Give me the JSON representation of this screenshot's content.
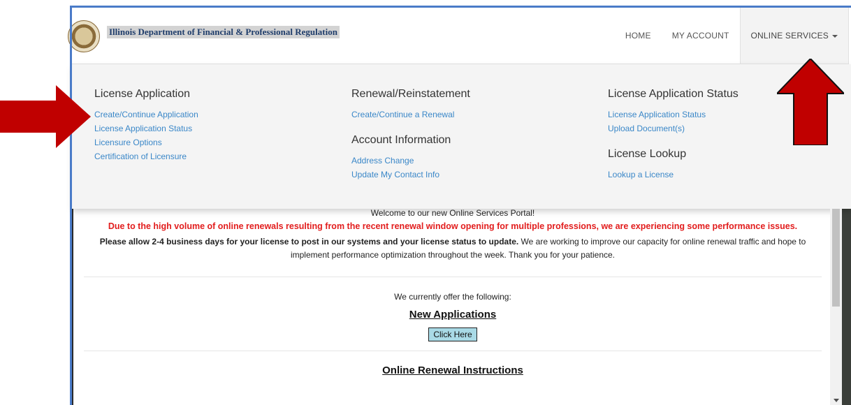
{
  "header": {
    "brand_name": "Illinois Department of Financial & Professional Regulation",
    "nav": {
      "home": "HOME",
      "my_account": "MY ACCOUNT",
      "online_services": "ONLINE SERVICES"
    }
  },
  "menu": {
    "license_application": {
      "title": "License Application",
      "links": [
        "Create/Continue Application",
        "License Application Status",
        "Licensure Options",
        "Certification of Licensure"
      ]
    },
    "renewal": {
      "title": "Renewal/Reinstatement",
      "links": [
        "Create/Continue a Renewal"
      ]
    },
    "account_information": {
      "title": "Account Information",
      "links": [
        "Address Change",
        "Update My Contact Info"
      ]
    },
    "application_status": {
      "title": "License Application Status",
      "links": [
        "License Application Status",
        "Upload Document(s)"
      ]
    },
    "license_lookup": {
      "title": "License Lookup",
      "links": [
        "Lookup a License"
      ]
    }
  },
  "content": {
    "welcome": "Welcome to our new Online Services Portal!",
    "warning": "Due to the high volume of online renewals resulting from the recent renewal window opening for multiple professions, we are experiencing some performance issues.",
    "notice_bold": "Please allow 2-4 business days for your license to post in our systems and your license status to update.",
    "notice_rest": " We are working to improve our capacity for online renewal traffic and hope to implement performance optimization throughout the week. Thank you for your patience.",
    "offer": "We currently offer the following:",
    "new_applications": "New Applications",
    "click_here": "Click Here",
    "online_renewal": "Online Renewal Instructions"
  },
  "colors": {
    "link": "#3a87c8",
    "warning": "#e21d1d",
    "button": "#a9dae6",
    "annotation_arrow": "#c00000"
  }
}
